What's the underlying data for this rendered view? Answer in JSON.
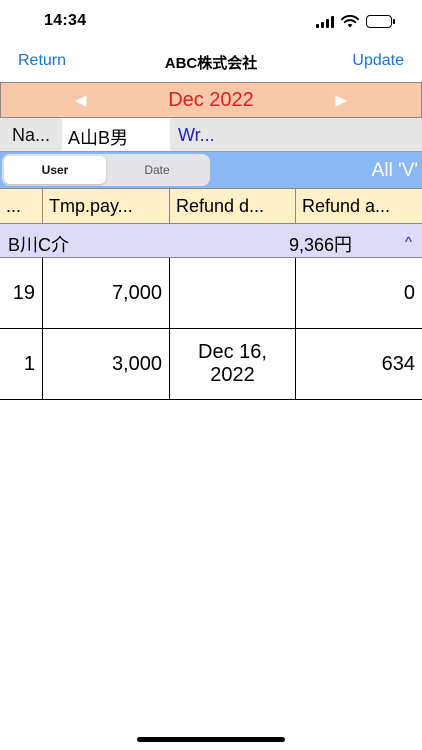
{
  "status_bar": {
    "time": "14:34"
  },
  "nav": {
    "return_label": "Return",
    "title": "ABC株式会社",
    "update_label": "Update"
  },
  "month_bar": {
    "prev_glyph": "◀",
    "label": "Dec 2022",
    "next_glyph": "▶"
  },
  "name_row": {
    "label": "Na...",
    "value": "A山B男",
    "link": "Wr..."
  },
  "tabs": {
    "items": [
      "User",
      "Date"
    ],
    "selected": "User",
    "filter_label": "All 'V'"
  },
  "table": {
    "headers": [
      "...",
      "Tmp.pay...",
      "Refund d...",
      "Refund a..."
    ],
    "group": {
      "name": "B川C介",
      "total": "9,366円",
      "toggle_glyph": "^"
    },
    "rows": [
      {
        "count": "19",
        "tmp_pay": "7,000",
        "refund_date": "",
        "refund_amount": "0"
      },
      {
        "count": "1",
        "tmp_pay": "3,000",
        "refund_date": "Dec 16, 2022",
        "refund_amount": "634"
      }
    ]
  },
  "colors": {
    "accent_blue": "#1a73d9",
    "month_bar_bg": "#f8c8a8",
    "month_text": "#e02020",
    "tab_row_bg": "#8ab8f2",
    "header_bg": "#fff0c8",
    "group_bg": "#dcdcf8"
  }
}
